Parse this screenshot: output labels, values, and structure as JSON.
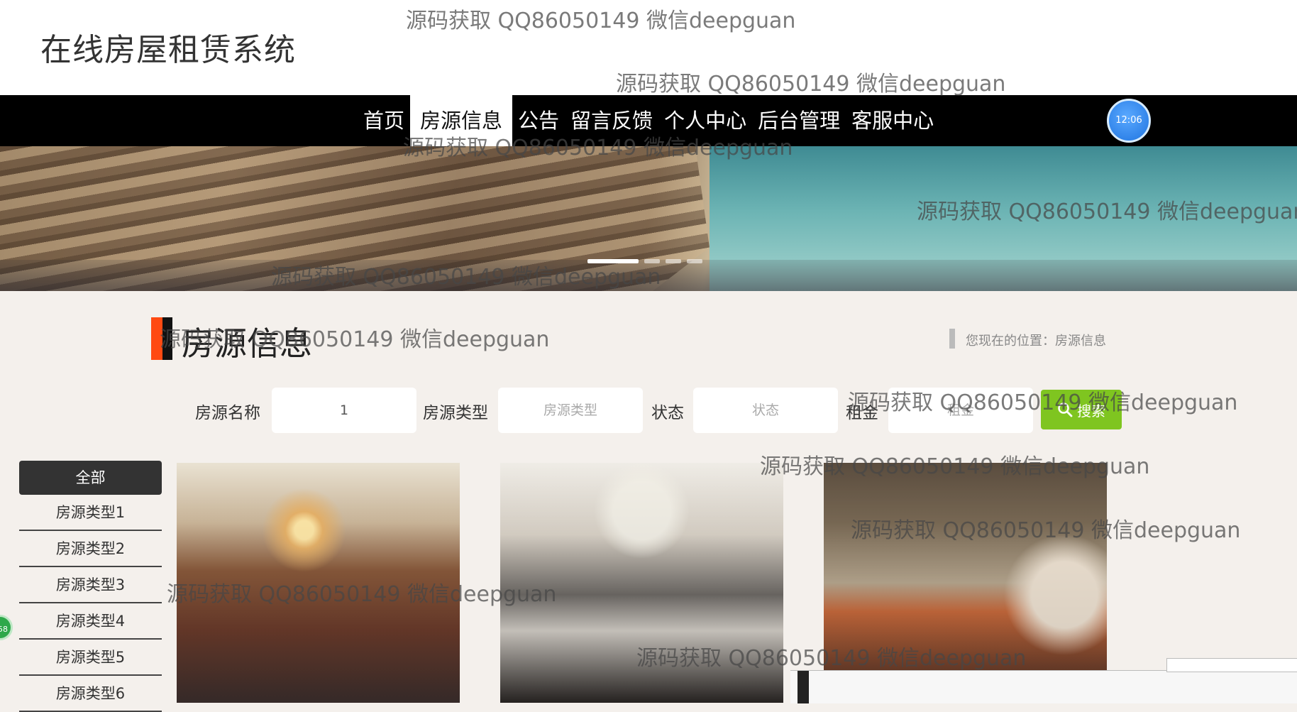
{
  "header": {
    "site_title": "在线房屋租赁系统"
  },
  "nav": {
    "items": [
      {
        "label": "首页"
      },
      {
        "label": "房源信息",
        "active": true
      },
      {
        "label": "公告"
      },
      {
        "label": "留言反馈"
      },
      {
        "label": "个人中心"
      },
      {
        "label": "后台管理"
      },
      {
        "label": "客服中心"
      }
    ]
  },
  "clock": {
    "time": "12:06"
  },
  "carousel": {
    "slide_count": 4,
    "active_index": 0
  },
  "section": {
    "title": "房源信息",
    "breadcrumb": "您现在的位置：房源信息"
  },
  "search": {
    "name_label": "房源名称",
    "name_value": "1",
    "type_label": "房源类型",
    "type_placeholder": "房源类型",
    "status_label": "状态",
    "status_placeholder": "状态",
    "rent_label": "租金",
    "rent_placeholder": "租金",
    "button_label": "搜索"
  },
  "categories": {
    "all_label": "全部",
    "items": [
      "房源类型1",
      "房源类型2",
      "房源类型3",
      "房源类型4",
      "房源类型5",
      "房源类型6"
    ]
  },
  "side_badge": {
    "text": "58"
  },
  "watermark": "源码获取 QQ86050149 微信deepguan",
  "colors": {
    "nav_bg": "#000000",
    "accent_orange": "#ff4a12",
    "search_green": "#7fc520",
    "page_bg": "#f4f0ec"
  },
  "icons": [
    "search-icon"
  ]
}
